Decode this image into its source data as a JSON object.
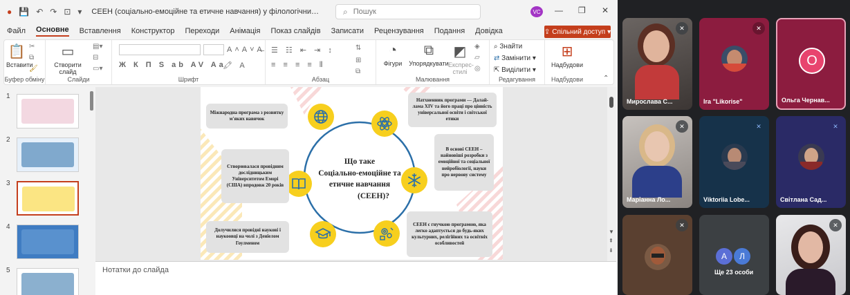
{
  "window": {
    "title": "СЕЕН (соціально-емоційне та етичне навчання) у філологічних дисциплінах - PowerP...",
    "search_placeholder": "Пошук",
    "user_initials": "VC",
    "share_label": "Спільний доступ"
  },
  "menu": [
    "Файл",
    "Основне",
    "Вставлення",
    "Конструктор",
    "Переходи",
    "Анімація",
    "Показ слайдів",
    "Записати",
    "Рецензування",
    "Подання",
    "Довідка"
  ],
  "menu_active": "Основне",
  "ribbon": {
    "paste": "Вставити",
    "clipboard": "Буфер обміну",
    "new_slide_1": "Створити",
    "new_slide_2": "слайд",
    "slides": "Слайди",
    "font_group": "Шрифт",
    "paragraph_group": "Абзац",
    "shapes": "Фігури",
    "arrange": "Упорядкувати",
    "quick_1": "Експрес-",
    "quick_2": "стилі",
    "drawing": "Малювання",
    "find": "Знайти",
    "replace": "Замінити",
    "select": "Виділити",
    "editing": "Редагування",
    "addins": "Надбудови",
    "addins_group": "Надбудови"
  },
  "thumbnails": [
    {
      "num": "1"
    },
    {
      "num": "2"
    },
    {
      "num": "3",
      "selected": true
    },
    {
      "num": "4"
    },
    {
      "num": "5"
    }
  ],
  "slide": {
    "center_title_1": "Що таке",
    "center_title_2": "Соціально-емоційне та",
    "center_title_3": "етичне навчання",
    "center_title_4": "(СЕЕН)?",
    "box_tl": "Міжнародна програма з розвитку м'яких навичок",
    "box_ml": "Створювалася провідним дослідницьким Університетом Еморі (США) впродовж 20 років",
    "box_bl": "Долучилися провідні наукові і наукоовці на чолі з Деніелом Гоулменом",
    "box_tr": "Натхненник програми — Далай-лама XIV та його праці про цінність універсальної освіти і світської етики",
    "box_mr": "В основі СЕЕН – найновіші розробки з емоційної та соціальної нейробіології, науки про нервову систему",
    "box_br": "СЕЕН є гнучкою програмою, яка легко адаптується до будь-яких культурних, релігійних та освітніх особливостей"
  },
  "notes_placeholder": "Нотатки до слайда",
  "participants": [
    {
      "name": "Мирослава С..."
    },
    {
      "name": "Ira \"Likorise\""
    },
    {
      "name": "Ольга Чернав...",
      "initial": "О"
    },
    {
      "name": "Маріанна Ло..."
    },
    {
      "name": "Viktoriia Lobe..."
    },
    {
      "name": "Світлана Сад..."
    },
    {
      "name": ""
    },
    {
      "name": "Ще 23 особи",
      "initials": [
        "А",
        "Л"
      ]
    },
    {
      "name": ""
    }
  ],
  "colors": {
    "accent": "#c43e1c",
    "slide_yellow": "#f7cf1e",
    "slide_blue": "#2b6fa8",
    "meet_bg": "#202124"
  }
}
